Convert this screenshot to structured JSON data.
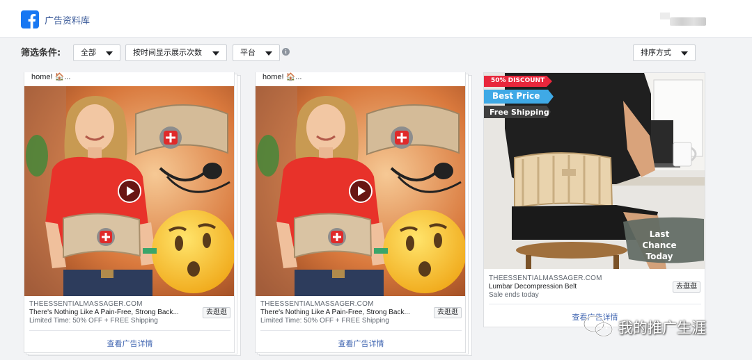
{
  "header": {
    "title": "广告资料库"
  },
  "filters": {
    "label": "筛选条件:",
    "all": "全部",
    "sort_by_impressions": "按时间显示展示次数",
    "platform": "平台",
    "sort_method": "排序方式"
  },
  "ads": [
    {
      "caption": "home! 🏠...",
      "domain": "THEESSENTIALMASSAGER.COM",
      "headline": "There's Nothing Like A Pain-Free, Strong Back...",
      "subline": "Limited Time: 50% OFF + FREE Shipping",
      "shop_button": "去逛逛",
      "detail_link": "查看广告详情"
    },
    {
      "caption": "home! 🏠...",
      "domain": "THEESSENTIALMASSAGER.COM",
      "headline": "There's Nothing Like A Pain-Free, Strong Back...",
      "subline": "Limited Time: 50% OFF + FREE Shipping",
      "shop_button": "去逛逛",
      "detail_link": "查看广告详情"
    },
    {
      "image_tags": [
        "50% DISCOUNT",
        "Best Price",
        "Free Shipping"
      ],
      "image_overlay": "Last Chance Today",
      "domain": "THEESSENTIALMASSAGER.COM",
      "headline": "Lumbar Decompression Belt",
      "subline": "Sale ends today",
      "shop_button": "去逛逛",
      "detail_link": "查看广告详情"
    }
  ],
  "watermark": "我的推广生涯",
  "colors": {
    "facebook_blue": "#1877f2",
    "link_blue": "#4267b2",
    "shirt_red": "#e8322a",
    "tag_red": "#e8273c",
    "tag_blue": "#3fa9e6"
  }
}
